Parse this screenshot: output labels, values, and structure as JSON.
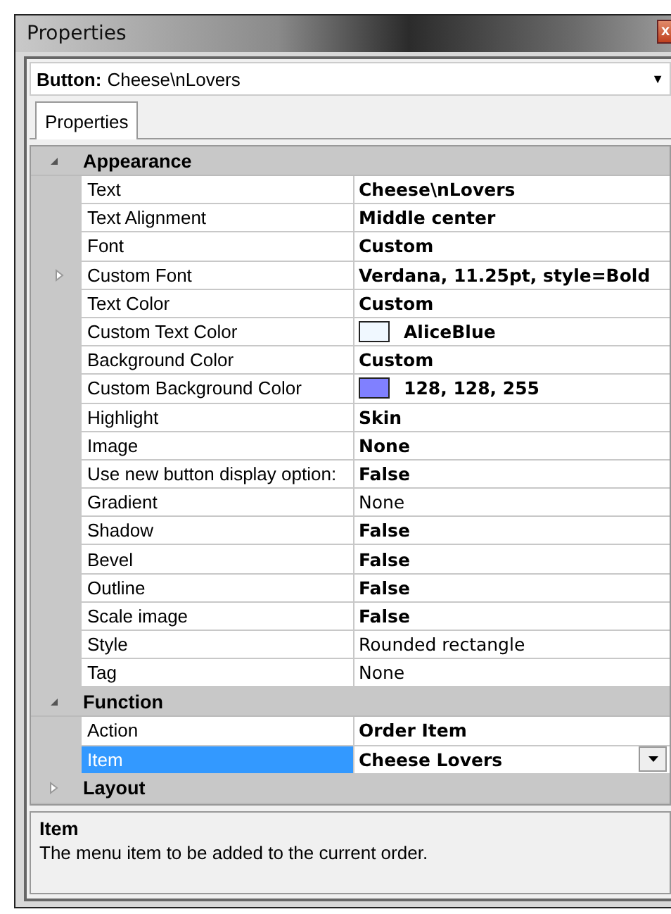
{
  "window": {
    "title": "Properties",
    "close": "x"
  },
  "object_selector": {
    "label": "Button:",
    "value": "Cheese\\nLovers",
    "arrow": "▼"
  },
  "tabs": [
    {
      "label": "Properties",
      "selected": true
    }
  ],
  "categories": [
    {
      "name": "Appearance",
      "expanded": true,
      "rows": [
        {
          "name": "Text",
          "value": "Cheese\\nLovers",
          "bold": true,
          "selected": false
        },
        {
          "name": "Text Alignment",
          "value": "Middle center",
          "bold": true,
          "selected": false
        },
        {
          "name": "Font",
          "value": "Custom",
          "bold": true,
          "selected": false
        },
        {
          "name": "Custom Font",
          "value": "Verdana, 11.25pt, style=Bold",
          "bold": true,
          "selected": false,
          "expanded": false
        },
        {
          "name": "Text Color",
          "value": "Custom",
          "bold": true,
          "selected": false
        },
        {
          "name": "Custom Text Color",
          "value": "AliceBlue",
          "bold": true,
          "selected": false,
          "kind": "color",
          "color": "#f0f8ff"
        },
        {
          "name": "Background Color",
          "value": "Custom",
          "bold": true,
          "selected": false
        },
        {
          "name": "Custom Background Color",
          "value": "128, 128, 255",
          "bold": true,
          "selected": false,
          "kind": "color",
          "color": "#8080ff"
        },
        {
          "name": "Highlight",
          "value": "Skin",
          "bold": true,
          "selected": false
        },
        {
          "name": "Image",
          "value": "None",
          "bold": true,
          "selected": false
        },
        {
          "name": "Use new button display option:",
          "value": "False",
          "bold": true,
          "selected": false
        },
        {
          "name": "Gradient",
          "value": "None",
          "bold": false,
          "selected": false
        },
        {
          "name": "Shadow",
          "value": "False",
          "bold": true,
          "selected": false
        },
        {
          "name": "Bevel",
          "value": "False",
          "bold": true,
          "selected": false
        },
        {
          "name": "Outline",
          "value": "False",
          "bold": true,
          "selected": false
        },
        {
          "name": "Scale image",
          "value": "False",
          "bold": true,
          "selected": false
        },
        {
          "name": "Style",
          "value": "Rounded rectangle",
          "bold": false,
          "selected": false
        },
        {
          "name": "Tag",
          "value": "None",
          "bold": false,
          "selected": false
        }
      ]
    },
    {
      "name": "Function",
      "expanded": true,
      "rows": [
        {
          "name": "Action",
          "value": "Order Item",
          "bold": true,
          "selected": false
        },
        {
          "name": "Item",
          "value": "Cheese Lovers",
          "bold": true,
          "selected": true,
          "kind": "dropdown"
        }
      ]
    },
    {
      "name": "Layout",
      "expanded": false
    }
  ],
  "help": {
    "title": "Item",
    "description": "The menu item to be added to the current order."
  }
}
